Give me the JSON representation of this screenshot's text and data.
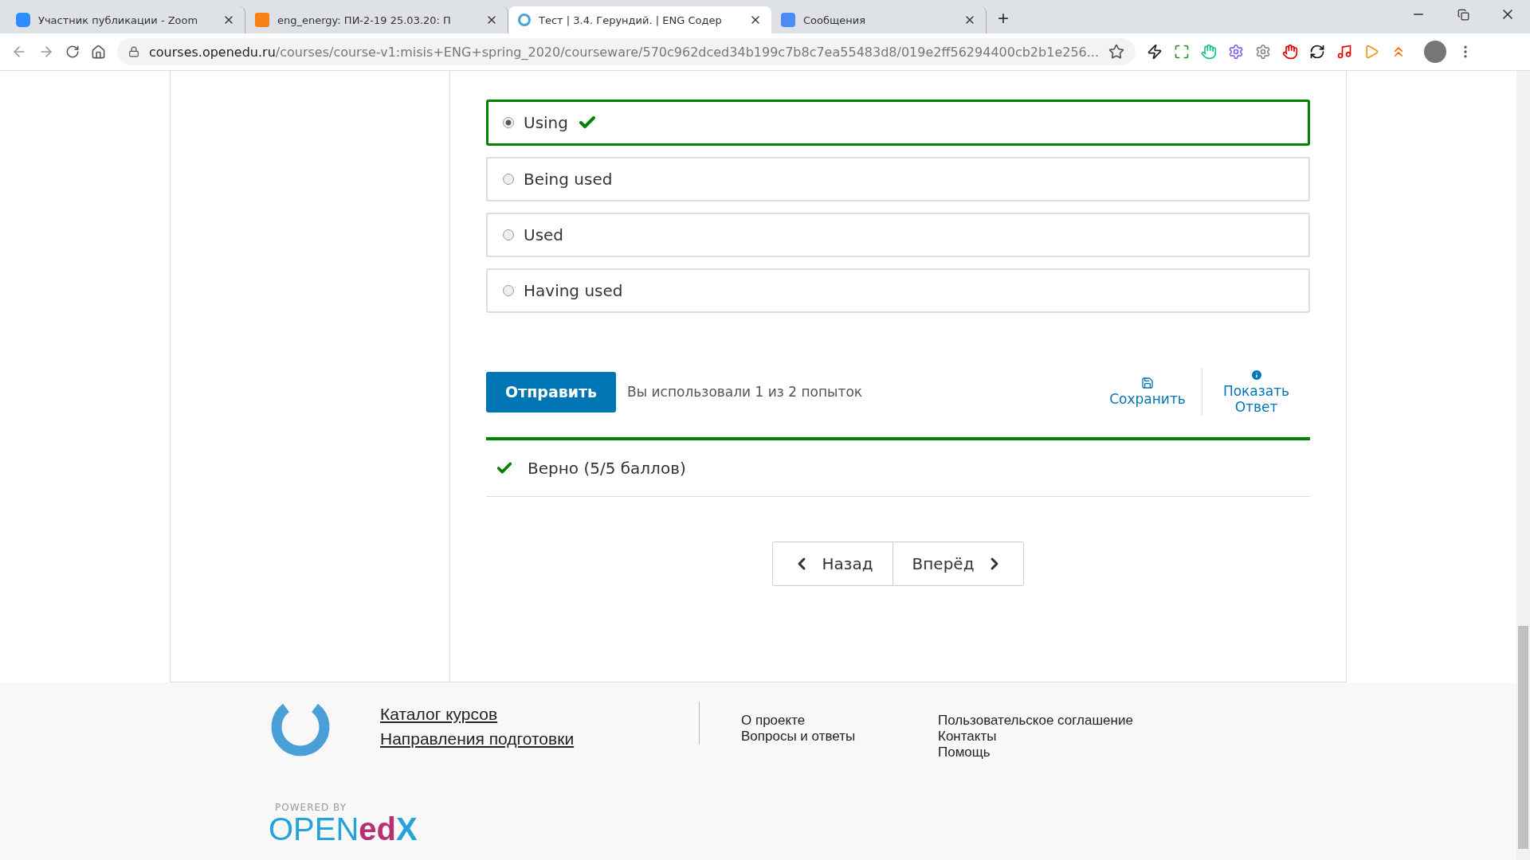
{
  "browser": {
    "tabs": [
      {
        "title": "Участник публикации - Zoom",
        "selected": false
      },
      {
        "title": "eng_energy: ПИ-2-19 25.03.20: П",
        "selected": false
      },
      {
        "title": "Тест | 3.4. Герундий. | ENG Содер",
        "selected": true
      },
      {
        "title": "Сообщения",
        "selected": false
      }
    ],
    "new_tab": "+",
    "url_host": "courses.openedu.ru",
    "url_path": "/courses/course-v1:misis+ENG+spring_2020/courseware/570c962dced34b199c7b8c7ea55483d8/019e2ff56294400cb2b1e256..."
  },
  "problem": {
    "options": [
      {
        "label": "Using",
        "selected": true,
        "correct": true
      },
      {
        "label": "Being used",
        "selected": false,
        "correct": false
      },
      {
        "label": "Used",
        "selected": false,
        "correct": false
      },
      {
        "label": "Having used",
        "selected": false,
        "correct": false
      }
    ],
    "submit": "Отправить",
    "attempts": "Вы использовали 1 из 2 попыток",
    "actions": [
      {
        "kind": "save",
        "label": "Сохранить"
      },
      {
        "kind": "answer",
        "label": "Показать Ответ"
      }
    ],
    "result": "Верно (5/5 баллов)"
  },
  "navigation": {
    "prev": "Назад",
    "next": "Вперёд"
  },
  "footer": {
    "main_links": [
      "Каталог курсов",
      "Направления подготовки"
    ],
    "links_col1": [
      "О проекте",
      "Вопросы и ответы"
    ],
    "links_col2": [
      "Пользовательское соглашение",
      "Контакты",
      "Помощь"
    ],
    "powered_by": "POWERED BY",
    "brand_open": "OPEN",
    "brand_ed": "ed",
    "brand_x": "X"
  }
}
